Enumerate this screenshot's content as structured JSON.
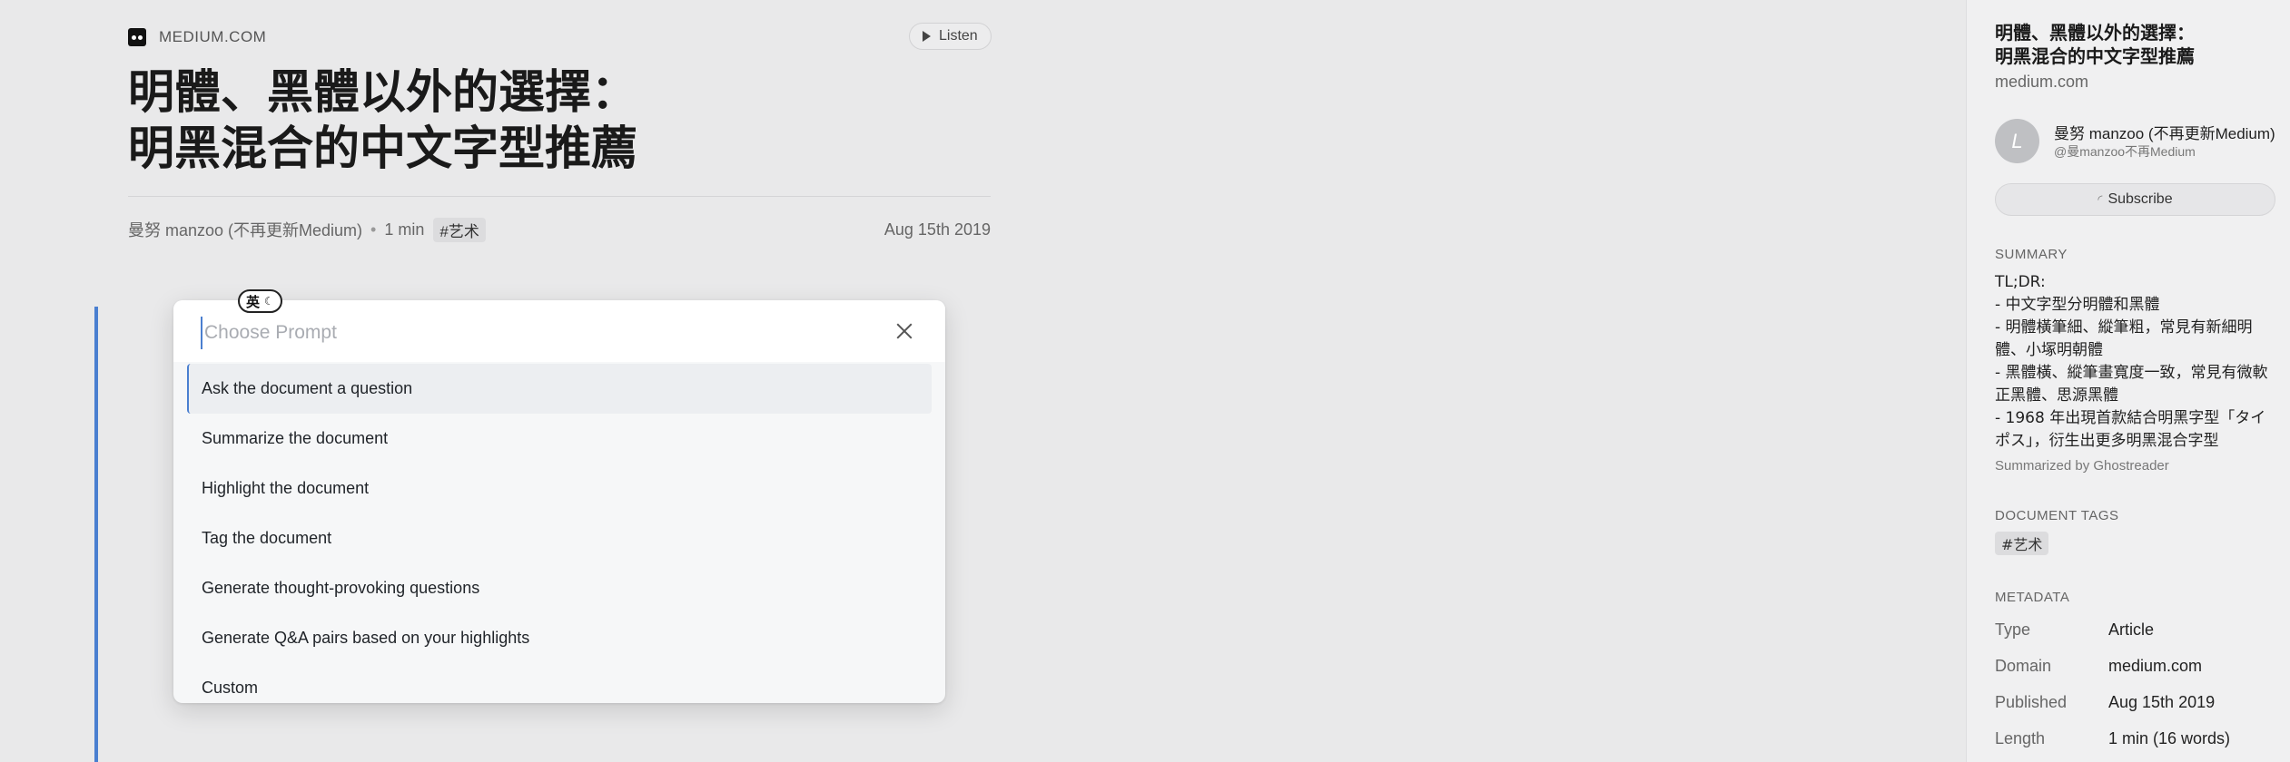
{
  "article": {
    "site_name": "MEDIUM.COM",
    "listen_label": "Listen",
    "title_line1": "明體、黑體以外的選擇：",
    "title_line2": "明黑混合的中文字型推薦",
    "author": "曼努 manzoo (不再更新Medium)",
    "separator": "•",
    "read_time": "1 min",
    "tag": "#艺术",
    "date": "Aug 15th 2019"
  },
  "ime_badge": {
    "label": "英",
    "moon": "☾"
  },
  "prompt_popup": {
    "placeholder": "Choose Prompt",
    "items": [
      "Ask the document a question",
      "Summarize the document",
      "Highlight the document",
      "Tag the document",
      "Generate thought-provoking questions",
      "Generate Q&A pairs based on your highlights",
      "Custom"
    ]
  },
  "sidebar": {
    "title_line1": "明體、黑體以外的選擇：",
    "title_line2": "明黑混合的中文字型推薦",
    "domain": "medium.com",
    "author_name": "曼努 manzoo (不再更新Medium)",
    "author_handle": "@曼manzoo不再Medium",
    "avatar_initial": "L",
    "subscribe_label": "Subscribe",
    "summary_label": "SUMMARY",
    "summary_lines": [
      "TL;DR:",
      "- 中文字型分明體和黑體",
      "- 明體橫筆細、縱筆粗，常見有新細明體、小塚明朝體",
      "- 黑體橫、縱筆畫寬度一致，常見有微軟正黑體、思源黑體",
      "- 1968 年出現首款結合明黑字型「タイポス」，衍生出更多明黑混合字型"
    ],
    "summarized_by": "Summarized by Ghostreader",
    "tags_label": "DOCUMENT TAGS",
    "tag": "#艺术",
    "metadata_label": "METADATA",
    "metadata": [
      {
        "key": "Type",
        "value": "Article"
      },
      {
        "key": "Domain",
        "value": "medium.com"
      },
      {
        "key": "Published",
        "value": "Aug 15th 2019"
      },
      {
        "key": "Length",
        "value": "1 min (16 words)"
      }
    ]
  },
  "colors": {
    "accent": "#4a7fd0",
    "page_bg": "#e9e9ea",
    "sidebar_bg": "#f0f0f1",
    "popup_bg": "#f6f7f8"
  }
}
